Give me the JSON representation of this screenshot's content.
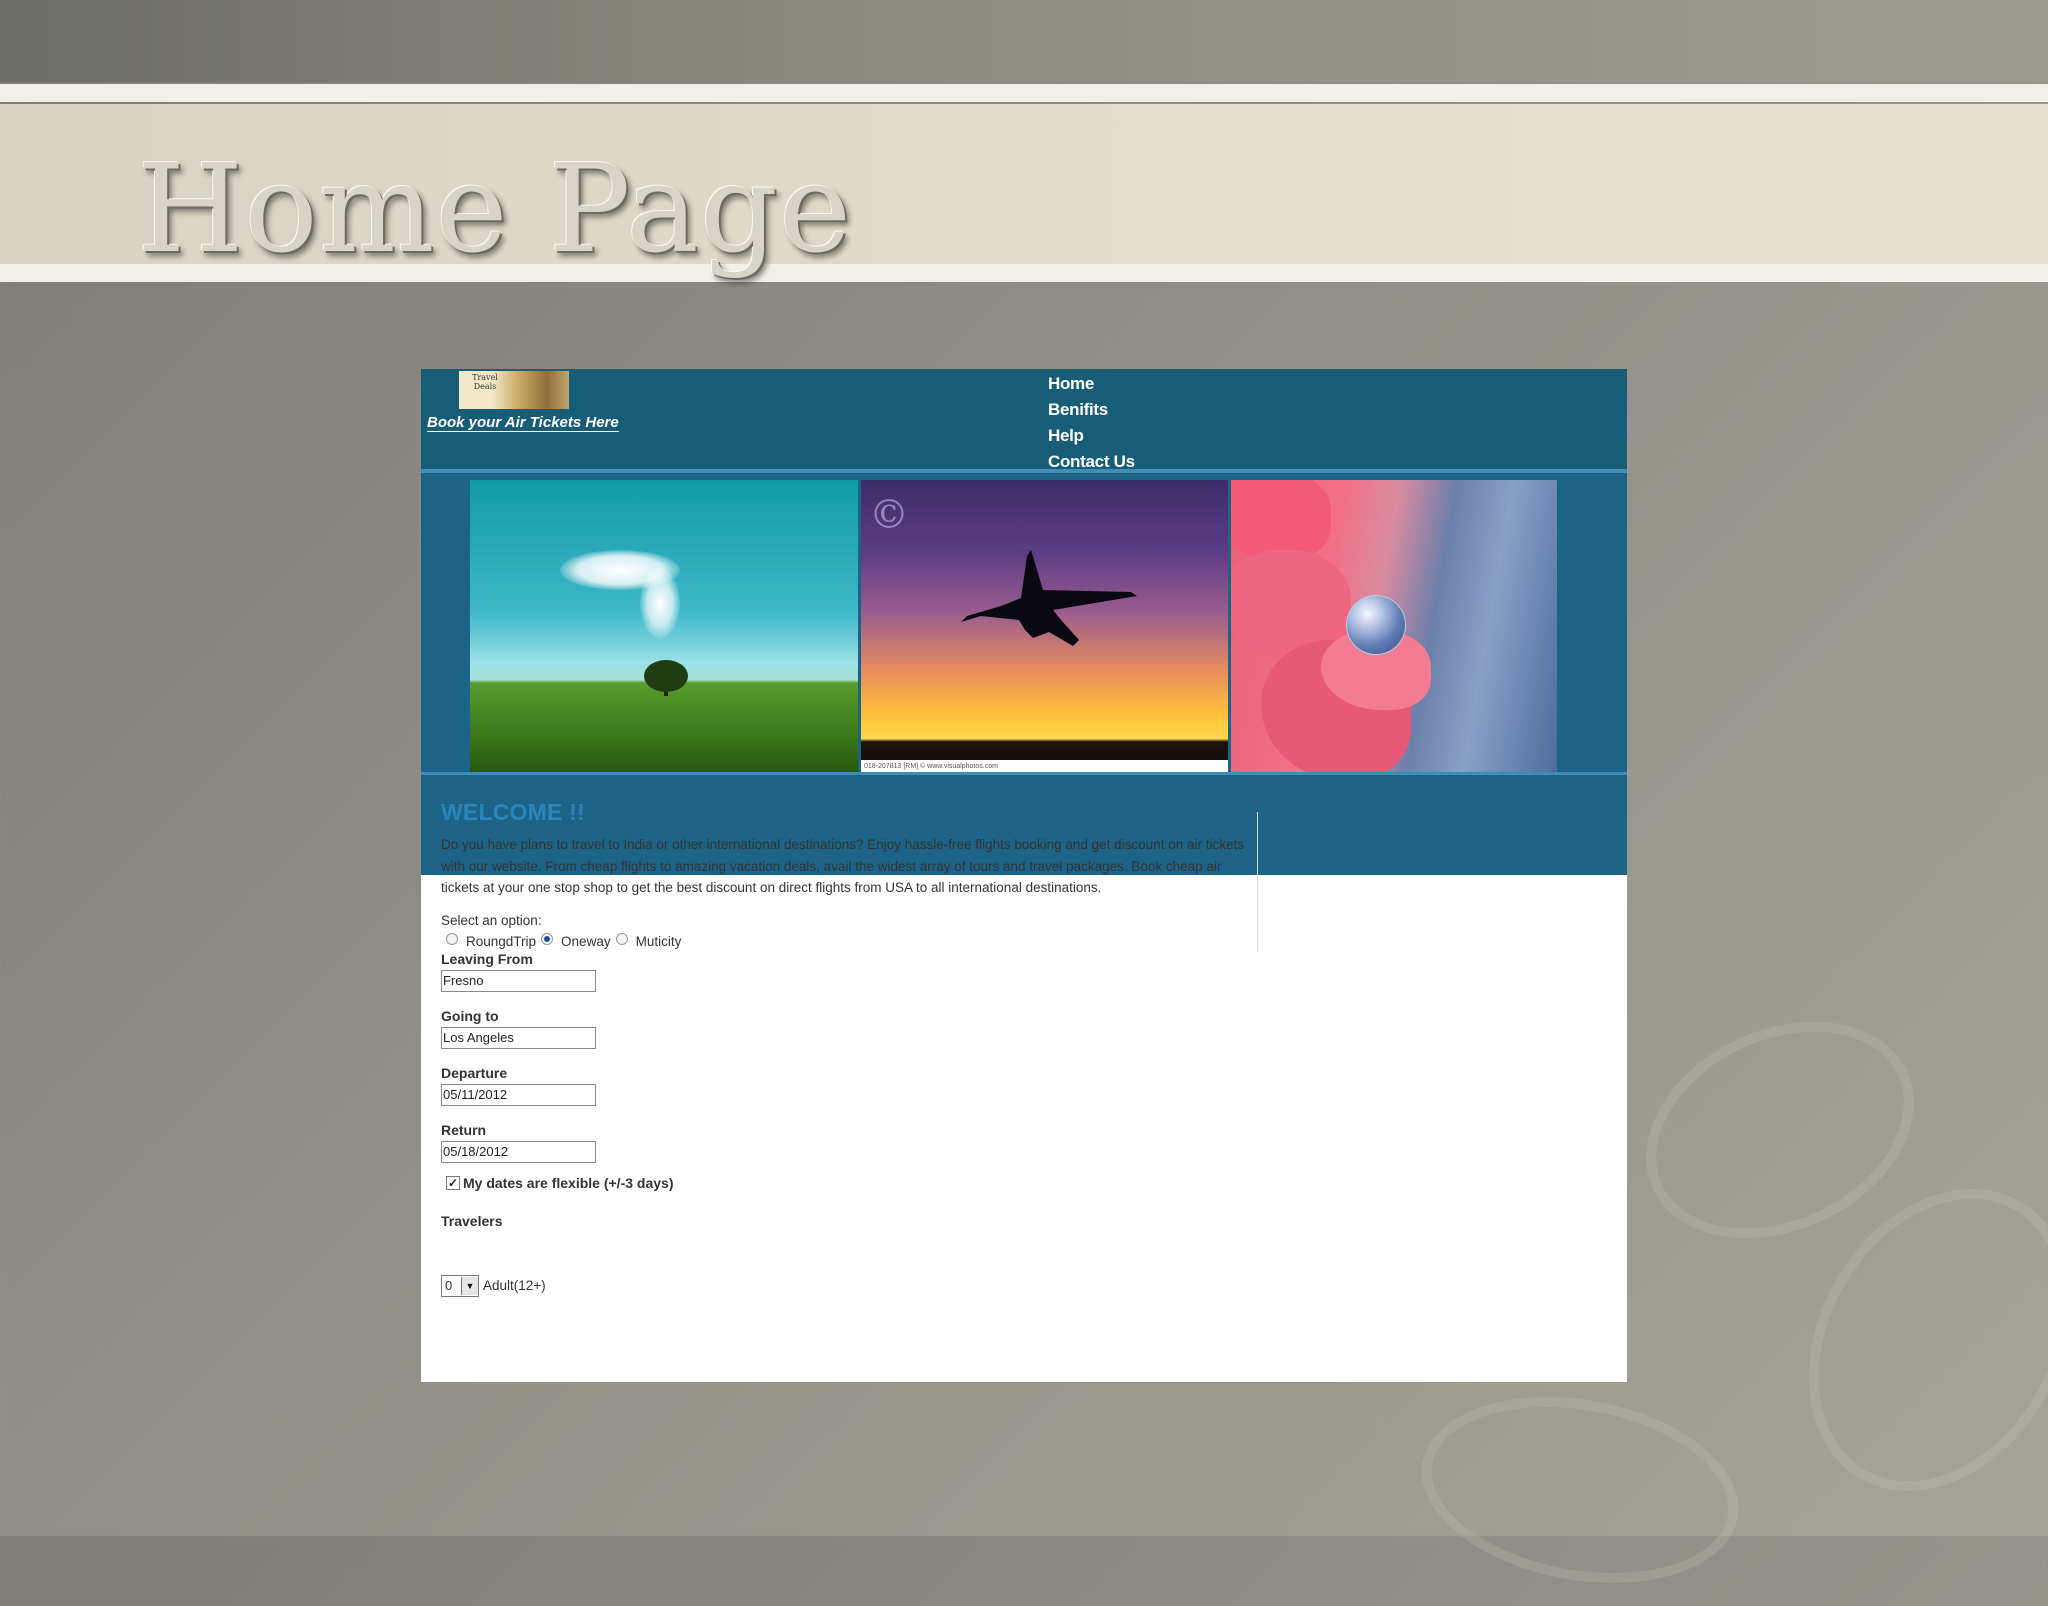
{
  "slide": {
    "title": "Home Page"
  },
  "site": {
    "logo_text": "Travel Deals",
    "tagline": "Book your Air Tickets Here",
    "nav": [
      "Home",
      "Benifits",
      "Help",
      "Contact Us"
    ],
    "photo_credit": "018-207813 [RM] © www.visualphotos.com",
    "welcome_title": "WELCOME !!",
    "intro": "Do you have plans to travel to India or other international destinations? Enjoy hassle-free flights booking and get discount on air tickets with our website. From cheap flights to amazing vacation deals, avail the widest array of tours and travel packages. Book cheap air tickets at your one stop shop to get the best discount on direct flights from USA to all international destinations.",
    "select_label": "Select an option:",
    "options": [
      "RoungdTrip",
      "Oneway",
      "Muticity"
    ],
    "selected_option": "Oneway",
    "fields": {
      "leaving_label": "Leaving From",
      "leaving_value": "Fresno",
      "going_label": "Going to",
      "going_value": "Los Angeles",
      "departure_label": "Departure",
      "departure_value": "05/11/2012",
      "return_label": "Return",
      "return_value": "05/18/2012"
    },
    "flexible_label": "My dates are flexible (+/-3 days)",
    "flexible_checked": true,
    "travelers_label": "Travelers",
    "adult_count": "0",
    "adult_label": "Adult(12+)"
  },
  "colors": {
    "header": "#185d78",
    "banner": "#1d6387",
    "welcome": "#2a86b8"
  }
}
